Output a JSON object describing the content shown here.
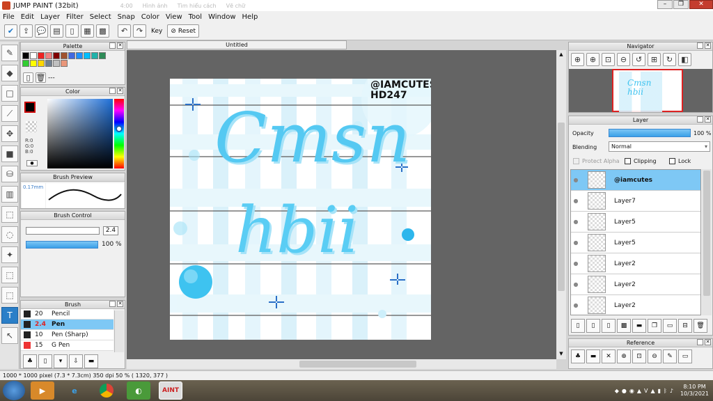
{
  "window": {
    "title": "JUMP PAINT (32bit)",
    "bg_tabs": [
      "4:00",
      "Hình ảnh",
      "Tìm hiểu cách",
      "Vẽ chữ"
    ]
  },
  "menu": [
    "File",
    "Edit",
    "Layer",
    "Filter",
    "Select",
    "Snap",
    "Color",
    "View",
    "Tool",
    "Window",
    "Help"
  ],
  "toolbar": {
    "key_label": "Key",
    "reset_label": "Reset"
  },
  "document": {
    "tab_title": "Untitled"
  },
  "artwork": {
    "watermark_line1": "@IAMCUTES",
    "watermark_line2": "HD247",
    "word1": "Cmsn",
    "word2": "hbii"
  },
  "palette": {
    "title": "Palette",
    "swatches": [
      "#000000",
      "#ffffff",
      "#ee2222",
      "#f08080",
      "#800000",
      "#a0522d",
      "#4169e1",
      "#1e90ff",
      "#00bfff",
      "#20b2aa",
      "#2e8b57",
      "#32cd32",
      "#ffff00",
      "#ffd700",
      "#708090",
      "#c0c0c0",
      "#e9967a"
    ],
    "name": "---"
  },
  "color": {
    "title": "Color",
    "r": "R:0",
    "g": "G:0",
    "b": "B:0"
  },
  "brush_preview": {
    "title": "Brush Preview",
    "size": "0.17mm"
  },
  "brush_control": {
    "title": "Brush Control",
    "size_value": "2.4",
    "opacity_value": "100 %"
  },
  "brush_list": {
    "title": "Brush",
    "items": [
      {
        "size": "20",
        "name": "Pencil",
        "selected": false
      },
      {
        "size": "2.4",
        "name": "Pen",
        "selected": true
      },
      {
        "size": "10",
        "name": "Pen (Sharp)",
        "selected": false
      },
      {
        "size": "15",
        "name": "G Pen",
        "selected": false
      }
    ]
  },
  "navigator": {
    "title": "Navigator"
  },
  "layer_panel": {
    "title": "Layer",
    "opacity_label": "Opacity",
    "opacity_value": "100 %",
    "opacity": 1.0,
    "blending_label": "Blending",
    "blending_value": "Normal",
    "protect_alpha": "Protect Alpha",
    "clipping": "Clipping",
    "lock": "Lock",
    "layers": [
      {
        "name": "@iamcutes",
        "selected": true
      },
      {
        "name": "Layer7",
        "selected": false
      },
      {
        "name": "Layer5",
        "selected": false
      },
      {
        "name": "Layer5",
        "selected": false
      },
      {
        "name": "Layer2",
        "selected": false
      },
      {
        "name": "Layer2",
        "selected": false
      },
      {
        "name": "Layer2",
        "selected": false
      }
    ]
  },
  "reference": {
    "title": "Reference"
  },
  "status": {
    "text": "1000 * 1000 pixel   (7.3 * 7.3cm)   350 dpi   50 %   ( 1320, 377 )"
  },
  "taskbar": {
    "time": "8:10 PM",
    "date": "10/3/2021",
    "app_label": "AINT"
  }
}
